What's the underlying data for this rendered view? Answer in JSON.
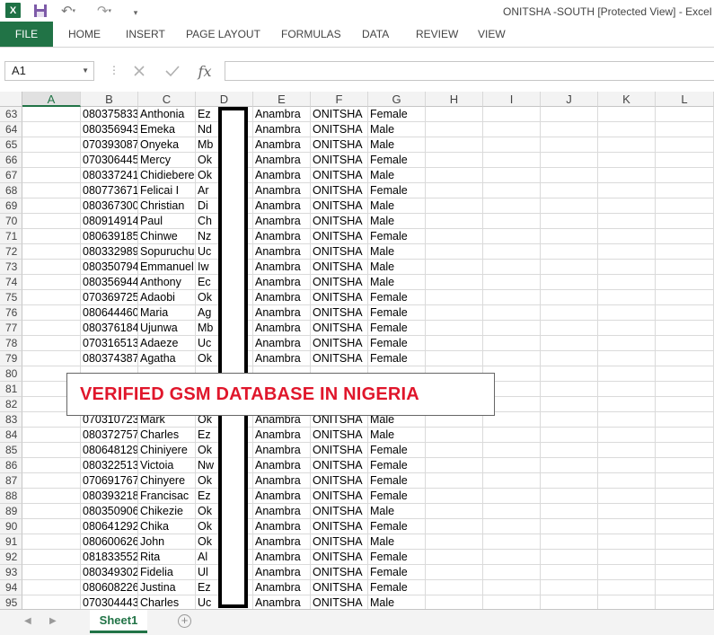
{
  "titlebar": {
    "title": "ONITSHA -SOUTH  [Protected View] - Excel",
    "excel_logo_text": "X",
    "undo_glyph": "↶",
    "redo_glyph": "↷",
    "dropdown_glyph": "▾",
    "qat_more_glyph": "▾"
  },
  "ribbon": {
    "tabs": [
      "FILE",
      "HOME",
      "INSERT",
      "PAGE LAYOUT",
      "FORMULAS",
      "DATA",
      "REVIEW",
      "VIEW"
    ]
  },
  "formula_bar": {
    "name_box": "A1",
    "name_box_arrow": "▼",
    "separator": "⋮",
    "fx_label": "fx",
    "formula": ""
  },
  "columns": [
    "A",
    "B",
    "C",
    "D",
    "E",
    "F",
    "G",
    "H",
    "I",
    "J",
    "K",
    "L"
  ],
  "selected_column": "A",
  "rows": [
    {
      "n": "63",
      "b": "080375833",
      "c": "Anthonia",
      "d": "Ez",
      "e": "Anambra",
      "f": "ONITSHA",
      "g": "Female"
    },
    {
      "n": "64",
      "b": "080356943",
      "c": "Emeka",
      "d": "Nd",
      "e": "Anambra",
      "f": "ONITSHA",
      "g": "Male"
    },
    {
      "n": "65",
      "b": "070393087",
      "c": "Onyeka",
      "d": "Mb",
      "e": "Anambra",
      "f": "ONITSHA",
      "g": "Male"
    },
    {
      "n": "66",
      "b": "070306445",
      "c": "Mercy",
      "d": "Ok",
      "e": "Anambra",
      "f": "ONITSHA",
      "g": "Female"
    },
    {
      "n": "67",
      "b": "080337241",
      "c": "Chidiebere",
      "d": "Ok",
      "e": "Anambra",
      "f": "ONITSHA",
      "g": "Male"
    },
    {
      "n": "68",
      "b": "080773671",
      "c": "Felicai I",
      "d": "Ar",
      "e": "Anambra",
      "f": "ONITSHA",
      "g": "Female"
    },
    {
      "n": "69",
      "b": "080367300",
      "c": "Christian",
      "d": "Di",
      "e": "Anambra",
      "f": "ONITSHA",
      "g": "Male"
    },
    {
      "n": "70",
      "b": "080914914",
      "c": "Paul",
      "d": "Ch",
      "e": "Anambra",
      "f": "ONITSHA",
      "g": "Male"
    },
    {
      "n": "71",
      "b": "080639185",
      "c": "Chinwe",
      "d": "Nz",
      "e": "Anambra",
      "f": "ONITSHA",
      "g": "Female"
    },
    {
      "n": "72",
      "b": "080332989",
      "c": "Sopuruchu",
      "d": "Uc",
      "e": "Anambra",
      "f": "ONITSHA",
      "g": "Male"
    },
    {
      "n": "73",
      "b": "080350794",
      "c": "Emmanuel",
      "d": "Iw",
      "e": "Anambra",
      "f": "ONITSHA",
      "g": "Male"
    },
    {
      "n": "74",
      "b": "080356944",
      "c": "Anthony",
      "d": "Ec",
      "e": "Anambra",
      "f": "ONITSHA",
      "g": "Male"
    },
    {
      "n": "75",
      "b": "070369725",
      "c": "Adaobi",
      "d": "Ok",
      "e": "Anambra",
      "f": "ONITSHA",
      "g": "Female"
    },
    {
      "n": "76",
      "b": "080644460",
      "c": "Maria",
      "d": "Ag",
      "e": "Anambra",
      "f": "ONITSHA",
      "g": "Female"
    },
    {
      "n": "77",
      "b": "080376184",
      "c": "Ujunwa",
      "d": "Mb",
      "e": "Anambra",
      "f": "ONITSHA",
      "g": "Female"
    },
    {
      "n": "78",
      "b": "070316513",
      "c": "Adaeze",
      "d": "Uc",
      "e": "Anambra",
      "f": "ONITSHA",
      "g": "Female"
    },
    {
      "n": "79",
      "b": "080374387",
      "c": "Agatha",
      "d": "Ok",
      "e": "Anambra",
      "f": "ONITSHA",
      "g": "Female"
    },
    {
      "n": "80",
      "b": "",
      "c": "",
      "d": "",
      "e": "",
      "f": "",
      "g": ""
    },
    {
      "n": "81",
      "b": "",
      "c": "",
      "d": "",
      "e": "",
      "f": "",
      "g": ""
    },
    {
      "n": "82",
      "b": "",
      "c": "",
      "d": "",
      "e": "",
      "f": "",
      "g": ""
    },
    {
      "n": "83",
      "b": "070310723",
      "c": "Mark",
      "d": "Ok",
      "e": "Anambra",
      "f": "ONITSHA",
      "g": "Male"
    },
    {
      "n": "84",
      "b": "080372757",
      "c": "Charles",
      "d": "Ez",
      "e": "Anambra",
      "f": "ONITSHA",
      "g": "Male"
    },
    {
      "n": "85",
      "b": "080648129",
      "c": "Chiniyere",
      "d": "Ok",
      "e": "Anambra",
      "f": "ONITSHA",
      "g": "Female"
    },
    {
      "n": "86",
      "b": "080322513",
      "c": "Victoia",
      "d": "Nw",
      "e": "Anambra",
      "f": "ONITSHA",
      "g": "Female"
    },
    {
      "n": "87",
      "b": "070691767",
      "c": "Chinyere",
      "d": "Ok",
      "e": "Anambra",
      "f": "ONITSHA",
      "g": "Female"
    },
    {
      "n": "88",
      "b": "080393218",
      "c": "Francisac",
      "d": "Ez",
      "e": "Anambra",
      "f": "ONITSHA",
      "g": "Female"
    },
    {
      "n": "89",
      "b": "080350906",
      "c": "Chikezie",
      "d": "Ok",
      "e": "Anambra",
      "f": "ONITSHA",
      "g": "Male"
    },
    {
      "n": "90",
      "b": "080641292",
      "c": "Chika",
      "d": "Ok",
      "e": "Anambra",
      "f": "ONITSHA",
      "g": "Female"
    },
    {
      "n": "91",
      "b": "080600626",
      "c": "John",
      "d": "Ok",
      "e": "Anambra",
      "f": "ONITSHA",
      "g": "Male"
    },
    {
      "n": "92",
      "b": "081833552",
      "c": "Rita",
      "d": "Al",
      "e": "Anambra",
      "f": "ONITSHA",
      "g": "Female"
    },
    {
      "n": "93",
      "b": "080349302",
      "c": "Fidelia",
      "d": "Ul",
      "e": "Anambra",
      "f": "ONITSHA",
      "g": "Female"
    },
    {
      "n": "94",
      "b": "080608226",
      "c": "Justina",
      "d": "Ez",
      "e": "Anambra",
      "f": "ONITSHA",
      "g": "Female"
    },
    {
      "n": "95",
      "b": "070304443",
      "c": "Charles",
      "d": "Uc",
      "e": "Anambra",
      "f": "ONITSHA",
      "g": "Male"
    }
  ],
  "banner": {
    "text": "VERIFIED GSM DATABASE IN NIGERIA",
    "color": "#e0162b"
  },
  "sheets": {
    "prev_glyph": "◀",
    "next_glyph": "▶",
    "active": "Sheet1",
    "add_glyph": "+"
  },
  "colors": {
    "excel_green": "#217346"
  }
}
